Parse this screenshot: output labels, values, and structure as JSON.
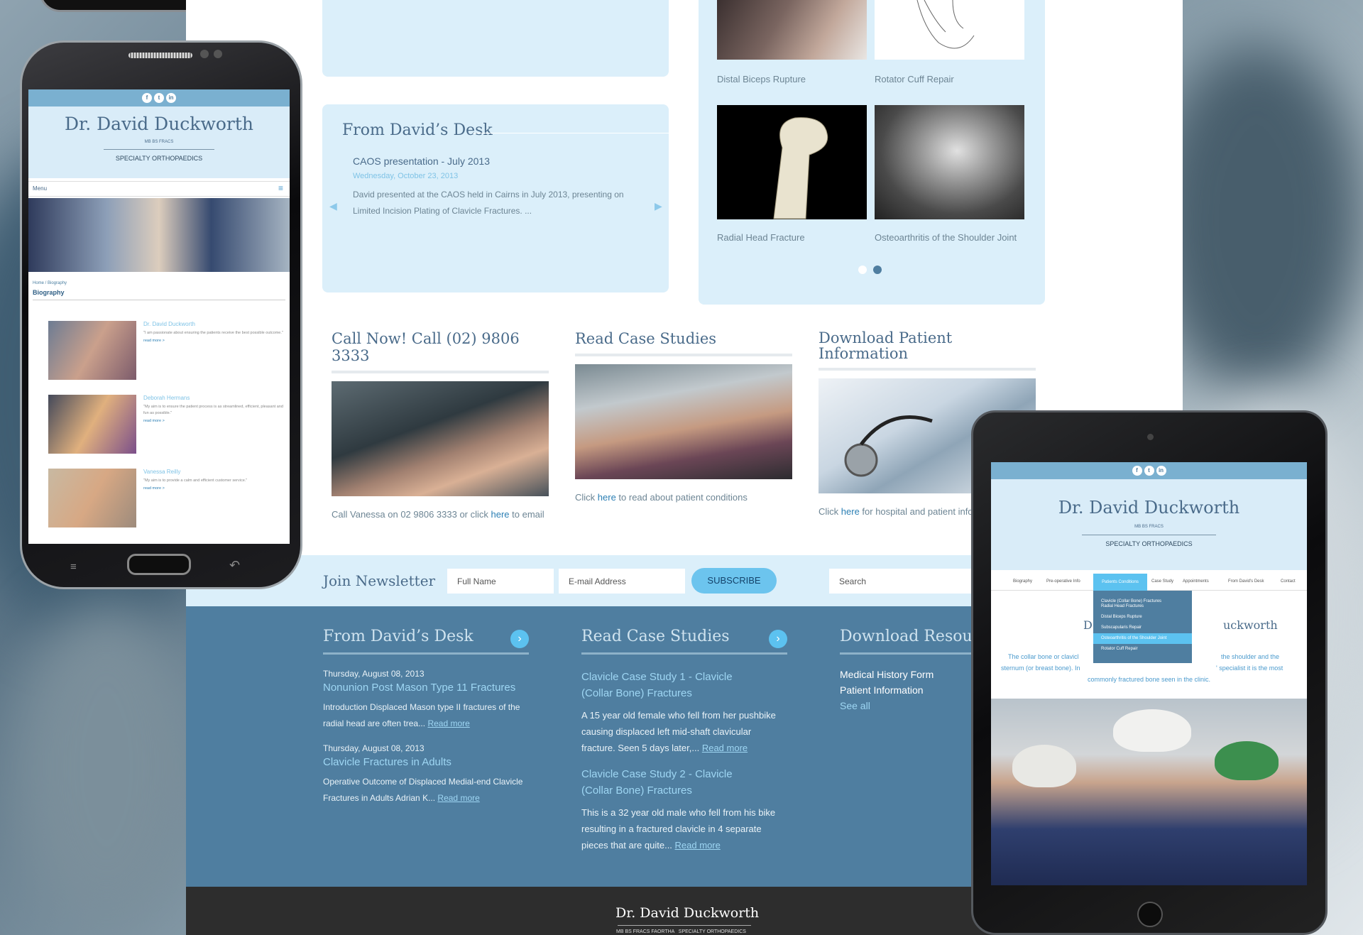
{
  "site": {
    "desk_panel": {
      "title": "From David’s Desk",
      "post_title": "CAOS presentation - July 2013",
      "post_date": "Wednesday, October 23, 2013",
      "post_excerpt": "David presented at the CAOS held in Cairns in July 2013, presenting on Limited Incision Plating of Clavicle Fractures. ..."
    },
    "gallery": {
      "captions": [
        "Distal Biceps Rupture",
        "Rotator Cuff Repair",
        "Radial Head Fracture",
        "Osteoarthritis of the Shoulder Joint"
      ],
      "slide_count": 2,
      "active_slide": 2
    },
    "columns": [
      {
        "title": "Call Now! Call (02) 9806 3333",
        "caption_pre": "Call Vanessa on 02 9806 3333 or click ",
        "link": "here",
        "caption_post": " to email"
      },
      {
        "title": "Read Case Studies",
        "caption_pre": "Click ",
        "link": "here",
        "caption_post": " to read about patient conditions"
      },
      {
        "title": "Download Patient Information",
        "caption_pre": "Click ",
        "link": "here",
        "caption_post": " for hospital and patient info"
      }
    ],
    "newsletter": {
      "label": "Join Newsletter",
      "name_placeholder": "Full Name",
      "email_placeholder": "E-mail Address",
      "subscribe": "SUBSCRIBE",
      "search_placeholder": "Search"
    },
    "footer": {
      "desk": {
        "title": "From David’s Desk",
        "items": [
          {
            "date": "Thursday, August 08, 2013",
            "title": "Nonunion Post Mason Type 11 Fractures",
            "text": "Introduction Displaced Mason type II fractures of the radial head are often trea...",
            "more": "Read more"
          },
          {
            "date": "Thursday, August 08, 2013",
            "title": "Clavicle Fractures in Adults",
            "text": "Operative Outcome of Displaced Medial-end Clavicle Fractures in Adults Adrian K...",
            "more": "Read more"
          }
        ]
      },
      "cases": {
        "title": "Read Case Studies",
        "items": [
          {
            "title": "Clavicle Case Study 1 - Clavicle (Collar Bone) Fractures",
            "text": "A 15 year old female who fell from her pushbike causing displaced left mid-shaft clavicular fracture. Seen 5 days later,...",
            "more": "Read more"
          },
          {
            "title": "Clavicle Case Study 2 - Clavicle (Collar Bone) Fractures",
            "text": "This is a 32 year old male who fell from his bike resulting in a fractured clavicle in 4 separate pieces that are quite...",
            "more": "Read more"
          }
        ]
      },
      "resources": {
        "title": "Download Resources",
        "links": [
          "Medical History Form",
          "Patient Information"
        ],
        "see_all": "See all"
      },
      "bottom_name": "Dr. David Duckworth",
      "bottom_sub": "MB BS FRACS FAORTHA   SPECIALTY ORTHOPAEDICS"
    }
  },
  "phone": {
    "name": "Dr. David Duckworth",
    "quals": "MB BS FRACS",
    "specialty": "SPECIALTY ORTHOPAEDICS",
    "menu": "Menu",
    "breadcrumb": "Home / Biography",
    "page_title": "Biography",
    "staff": [
      {
        "name": "Dr. David Duckworth",
        "quote": "\"I am passionate about ensuring the patients receive the best possible outcome.\"",
        "more": "read more >"
      },
      {
        "name": "Deborah Hermans",
        "quote": "\"My aim is to ensure the patient process is as streamlined, efficient, pleasant and fun as possible.\"",
        "more": "read more >"
      },
      {
        "name": "Vanessa Reilly",
        "quote": "\"My aim is to provide a calm and efficient customer service.\"",
        "more": "read more >"
      }
    ]
  },
  "tablet": {
    "name": "Dr. David Duckworth",
    "quals": "MB BS FRACS",
    "specialty": "SPECIALTY ORTHOPAEDICS",
    "nav": [
      "Biography",
      "Pre-operative Info",
      "Patients Conditions",
      "Case Study",
      "Appointments",
      "From David's Desk",
      "Contact"
    ],
    "nav_active": "Patients Conditions",
    "dropdown": [
      "Clavicle (Collar Bone) Fractures",
      "Radial Head Fractures",
      "Distal Biceps Rupture",
      "Subscapularis Repair",
      "Osteoarthritis of the Shoulder Joint",
      "Rotator Cuff Repair"
    ],
    "dropdown_active": "Osteoarthritis of the Shoulder Joint",
    "heading_fragment_left": "D",
    "heading_fragment_right": "uckworth",
    "body_left_1": "The collar bone or clavicl",
    "body_left_2": "sternum (or breast bone). In",
    "body_right_1": "the shoulder and the",
    "body_right_2": "' specialist it is the most",
    "body_line_3": "commonly fractured bone seen in the clinic."
  },
  "colors": {
    "accent": "#5cc2f0",
    "panel": "#dbeffa",
    "footer": "#4f7ea0",
    "header_blue": "#b9dcf1",
    "dark": "#2d2d2d"
  }
}
